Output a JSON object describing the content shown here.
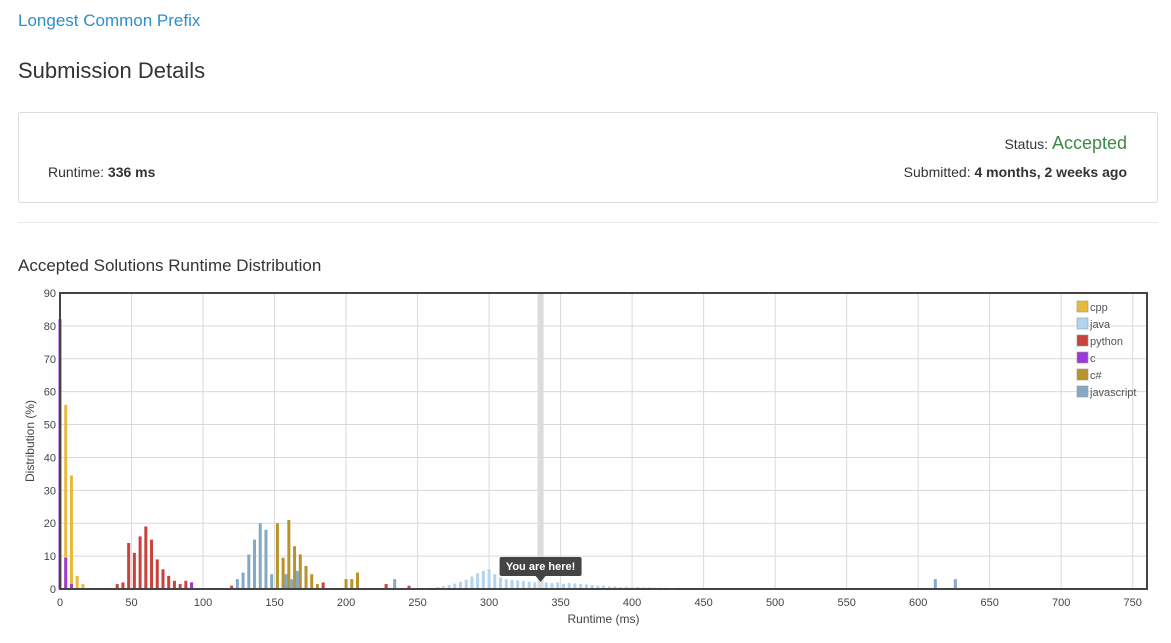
{
  "problem": {
    "title": "Longest Common Prefix"
  },
  "page": {
    "title": "Submission Details"
  },
  "details": {
    "runtime_label": "Runtime:",
    "runtime_value": "336 ms",
    "status_label": "Status:",
    "status_value": "Accepted",
    "submitted_label": "Submitted:",
    "submitted_value": "4 months, 2 weeks ago"
  },
  "colors": {
    "link": "#2a8fcf",
    "accepted": "#3c8a4a"
  },
  "chart_data": {
    "type": "bar",
    "title": "Accepted Solutions Runtime Distribution",
    "xlabel": "Runtime (ms)",
    "ylabel": "Distribution (%)",
    "xlim": [
      0,
      760
    ],
    "ylim": [
      0,
      90
    ],
    "xticks": [
      0,
      50,
      100,
      150,
      200,
      250,
      300,
      350,
      400,
      450,
      500,
      550,
      600,
      650,
      700,
      750
    ],
    "yticks": [
      0,
      10,
      20,
      30,
      40,
      50,
      60,
      70,
      80,
      90
    ],
    "grid": true,
    "legend_position": "top-right",
    "marker": {
      "x": 336,
      "label": "You are here!"
    },
    "series": [
      {
        "name": "cpp",
        "color": "#e8b93b",
        "points": [
          [
            4,
            56
          ],
          [
            8,
            34.5
          ],
          [
            12,
            4
          ],
          [
            16,
            1.5
          ]
        ]
      },
      {
        "name": "java",
        "color": "#b3d4f0",
        "points": [
          [
            256,
            0.3
          ],
          [
            260,
            0.4
          ],
          [
            264,
            0.6
          ],
          [
            268,
            0.9
          ],
          [
            272,
            1.2
          ],
          [
            276,
            1.6
          ],
          [
            280,
            2.2
          ],
          [
            284,
            2.8
          ],
          [
            288,
            3.8
          ],
          [
            292,
            4.8
          ],
          [
            296,
            5.5
          ],
          [
            300,
            6.0
          ],
          [
            304,
            4.5
          ],
          [
            308,
            3.5
          ],
          [
            312,
            3.0
          ],
          [
            316,
            2.8
          ],
          [
            320,
            2.6
          ],
          [
            324,
            2.4
          ],
          [
            328,
            2.2
          ],
          [
            332,
            2.0
          ],
          [
            340,
            2.0
          ],
          [
            344,
            1.8
          ],
          [
            348,
            2.0
          ],
          [
            352,
            1.6
          ],
          [
            356,
            1.8
          ],
          [
            360,
            1.7
          ],
          [
            364,
            1.5
          ],
          [
            368,
            1.4
          ],
          [
            372,
            1.2
          ],
          [
            376,
            1.0
          ],
          [
            380,
            1.0
          ],
          [
            384,
            0.8
          ],
          [
            388,
            0.8
          ],
          [
            392,
            0.6
          ],
          [
            396,
            0.7
          ],
          [
            400,
            0.5
          ],
          [
            404,
            0.6
          ],
          [
            408,
            0.5
          ],
          [
            412,
            0.5
          ],
          [
            416,
            0.4
          ],
          [
            420,
            0.4
          ],
          [
            424,
            0.4
          ],
          [
            428,
            0.3
          ],
          [
            432,
            0.4
          ],
          [
            436,
            0.3
          ],
          [
            440,
            0.3
          ],
          [
            444,
            0.3
          ],
          [
            448,
            0.3
          ],
          [
            452,
            0.3
          ],
          [
            460,
            0.3
          ],
          [
            468,
            0.3
          ],
          [
            476,
            0.3
          ],
          [
            484,
            0.3
          ],
          [
            492,
            0.3
          ],
          [
            500,
            0.3
          ],
          [
            512,
            0.3
          ],
          [
            524,
            0.3
          ],
          [
            548,
            0.3
          ],
          [
            572,
            0.3
          ],
          [
            620,
            0.3
          ],
          [
            660,
            0.3
          ],
          [
            688,
            0.3
          ]
        ]
      },
      {
        "name": "python",
        "color": "#c9433d",
        "points": [
          [
            40,
            1.5
          ],
          [
            44,
            2
          ],
          [
            48,
            14
          ],
          [
            52,
            11
          ],
          [
            56,
            16
          ],
          [
            60,
            19
          ],
          [
            64,
            15
          ],
          [
            68,
            9
          ],
          [
            72,
            6
          ],
          [
            76,
            4
          ],
          [
            80,
            2.5
          ],
          [
            84,
            1.5
          ],
          [
            88,
            2.5
          ],
          [
            92,
            2
          ],
          [
            120,
            1
          ],
          [
            184,
            2
          ],
          [
            228,
            1.5
          ],
          [
            244,
            1
          ]
        ]
      },
      {
        "name": "c",
        "color": "#9a3ad8",
        "points": [
          [
            0,
            82
          ],
          [
            4,
            9.5
          ],
          [
            8,
            1.5
          ],
          [
            92,
            2
          ]
        ]
      },
      {
        "name": "c#",
        "color": "#b8932c",
        "points": [
          [
            152,
            20
          ],
          [
            156,
            9.5
          ],
          [
            160,
            21
          ],
          [
            164,
            13
          ],
          [
            168,
            10.5
          ],
          [
            172,
            7
          ],
          [
            176,
            4.5
          ],
          [
            180,
            1.5
          ],
          [
            200,
            3
          ],
          [
            204,
            3
          ],
          [
            208,
            5
          ]
        ]
      },
      {
        "name": "javascript",
        "color": "#84a8c8",
        "points": [
          [
            124,
            3
          ],
          [
            128,
            5
          ],
          [
            132,
            10.5
          ],
          [
            136,
            15
          ],
          [
            140,
            20
          ],
          [
            144,
            18
          ],
          [
            148,
            4.5
          ],
          [
            158,
            4.5
          ],
          [
            162,
            3
          ],
          [
            166,
            5.5
          ],
          [
            234,
            3
          ],
          [
            612,
            3
          ],
          [
            626,
            3
          ]
        ]
      }
    ]
  }
}
